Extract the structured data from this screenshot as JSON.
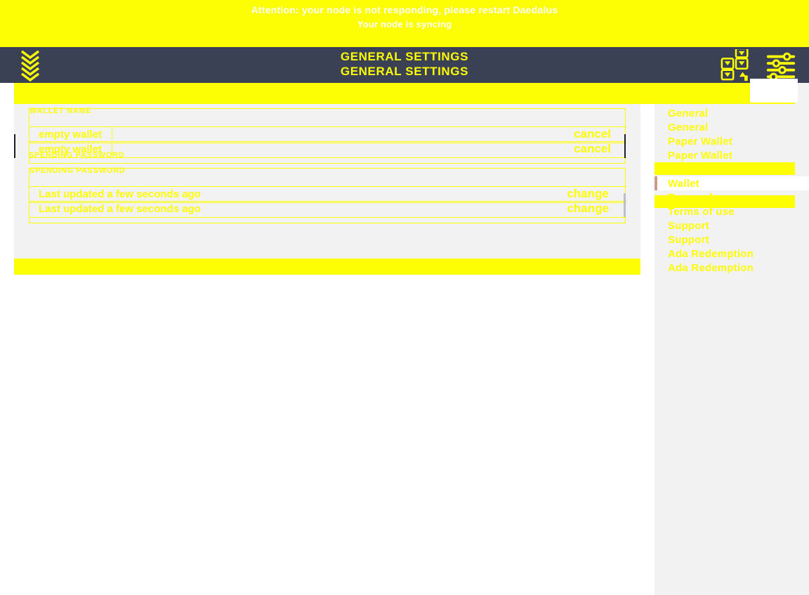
{
  "app": {
    "brand_logo": "daedalus-chevron-logo",
    "navbar_bg": "#3b4154",
    "accent_yellow": "#fdfd03",
    "panel_bg": "#f2f2f3",
    "active_accent": "#cf9a8e"
  },
  "banner": {
    "line1": "Attention: your node is not responding, please restart Daedalus",
    "line2": "Your node is syncing"
  },
  "navbar": {
    "title": "GENERAL SETTINGS",
    "title_duplicate": "GENERAL SETTINGS",
    "icons": [
      {
        "name": "wallets-grid-icon",
        "glyph": "wallets"
      },
      {
        "name": "settings-sliders-icon",
        "glyph": "sliders"
      }
    ]
  },
  "settings_menu": {
    "items": [
      {
        "label": "General",
        "active": false
      },
      {
        "label": "General",
        "active": false
      },
      {
        "label": "Paper Wallet",
        "active": false
      },
      {
        "label": "Paper Wallet",
        "active": false
      },
      {
        "label": "Wallet",
        "active": false
      },
      {
        "label": "Wallet",
        "active": true
      },
      {
        "label": "Terms of use",
        "active": false
      },
      {
        "label": "Terms of use",
        "active": false
      },
      {
        "label": "Support",
        "active": false
      },
      {
        "label": "Support",
        "active": false
      },
      {
        "label": "Ada Redemption",
        "active": false
      },
      {
        "label": "Ada Redemption",
        "active": false
      }
    ]
  },
  "main": {
    "wallet_name": {
      "label": "WALLET NAME",
      "label_duplicate": "WALLET NAME",
      "value": "empty wallet",
      "value_duplicate": "empty wallet",
      "action": "cancel",
      "action_duplicate": "cancel"
    },
    "spending_password": {
      "label": "SPENDING PASSWORD",
      "label_duplicate": "SPENDING PASSWORD",
      "value": "Last updated a few seconds ago",
      "value_duplicate": "Last updated a few seconds ago",
      "action": "change",
      "action_duplicate": "change"
    }
  }
}
